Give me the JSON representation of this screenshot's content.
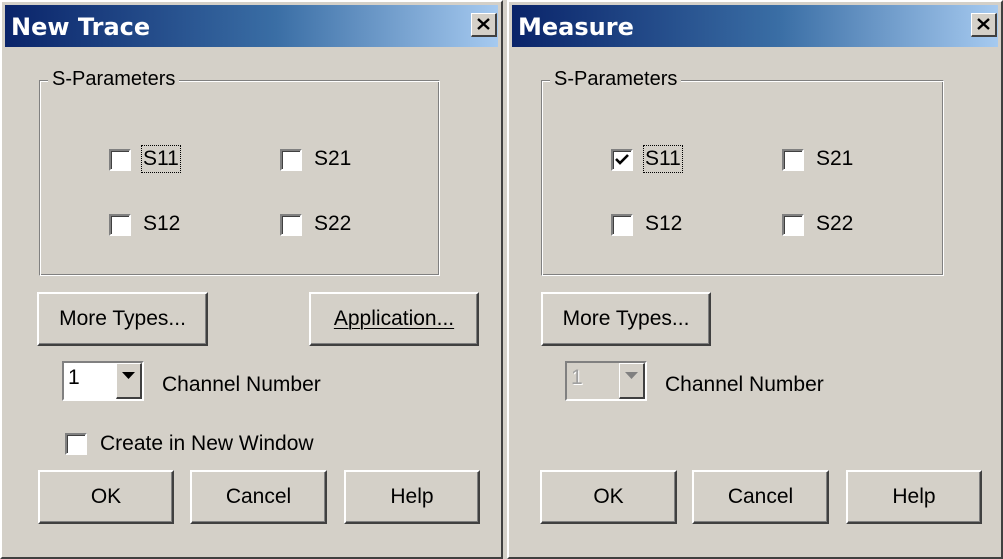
{
  "new_trace": {
    "title": "New Trace",
    "group_label": "S-Parameters",
    "checkboxes": [
      {
        "label": "S11",
        "checked": false
      },
      {
        "label": "S21",
        "checked": false
      },
      {
        "label": "S12",
        "checked": false
      },
      {
        "label": "S22",
        "checked": false
      }
    ],
    "more_types_label": "More Types...",
    "application_label": "Application...",
    "channel_value": "1",
    "channel_label": "Channel Number",
    "create_window_label": "Create in New Window",
    "create_window_checked": false,
    "ok_label": "OK",
    "cancel_label": "Cancel",
    "help_label": "Help"
  },
  "measure": {
    "title": "Measure",
    "group_label": "S-Parameters",
    "checkboxes": [
      {
        "label": "S11",
        "checked": true
      },
      {
        "label": "S21",
        "checked": false
      },
      {
        "label": "S12",
        "checked": false
      },
      {
        "label": "S22",
        "checked": false
      }
    ],
    "more_types_label": "More Types...",
    "channel_value": "1",
    "channel_label": "Channel Number",
    "channel_disabled": true,
    "ok_label": "OK",
    "cancel_label": "Cancel",
    "help_label": "Help"
  },
  "icons": {
    "close": "close-icon",
    "dropdown": "chevron-down-icon",
    "check": "check-icon"
  },
  "colors": {
    "titlebar_start": "#0a246a",
    "titlebar_end": "#a6caf0",
    "face": "#d4d0c8"
  }
}
